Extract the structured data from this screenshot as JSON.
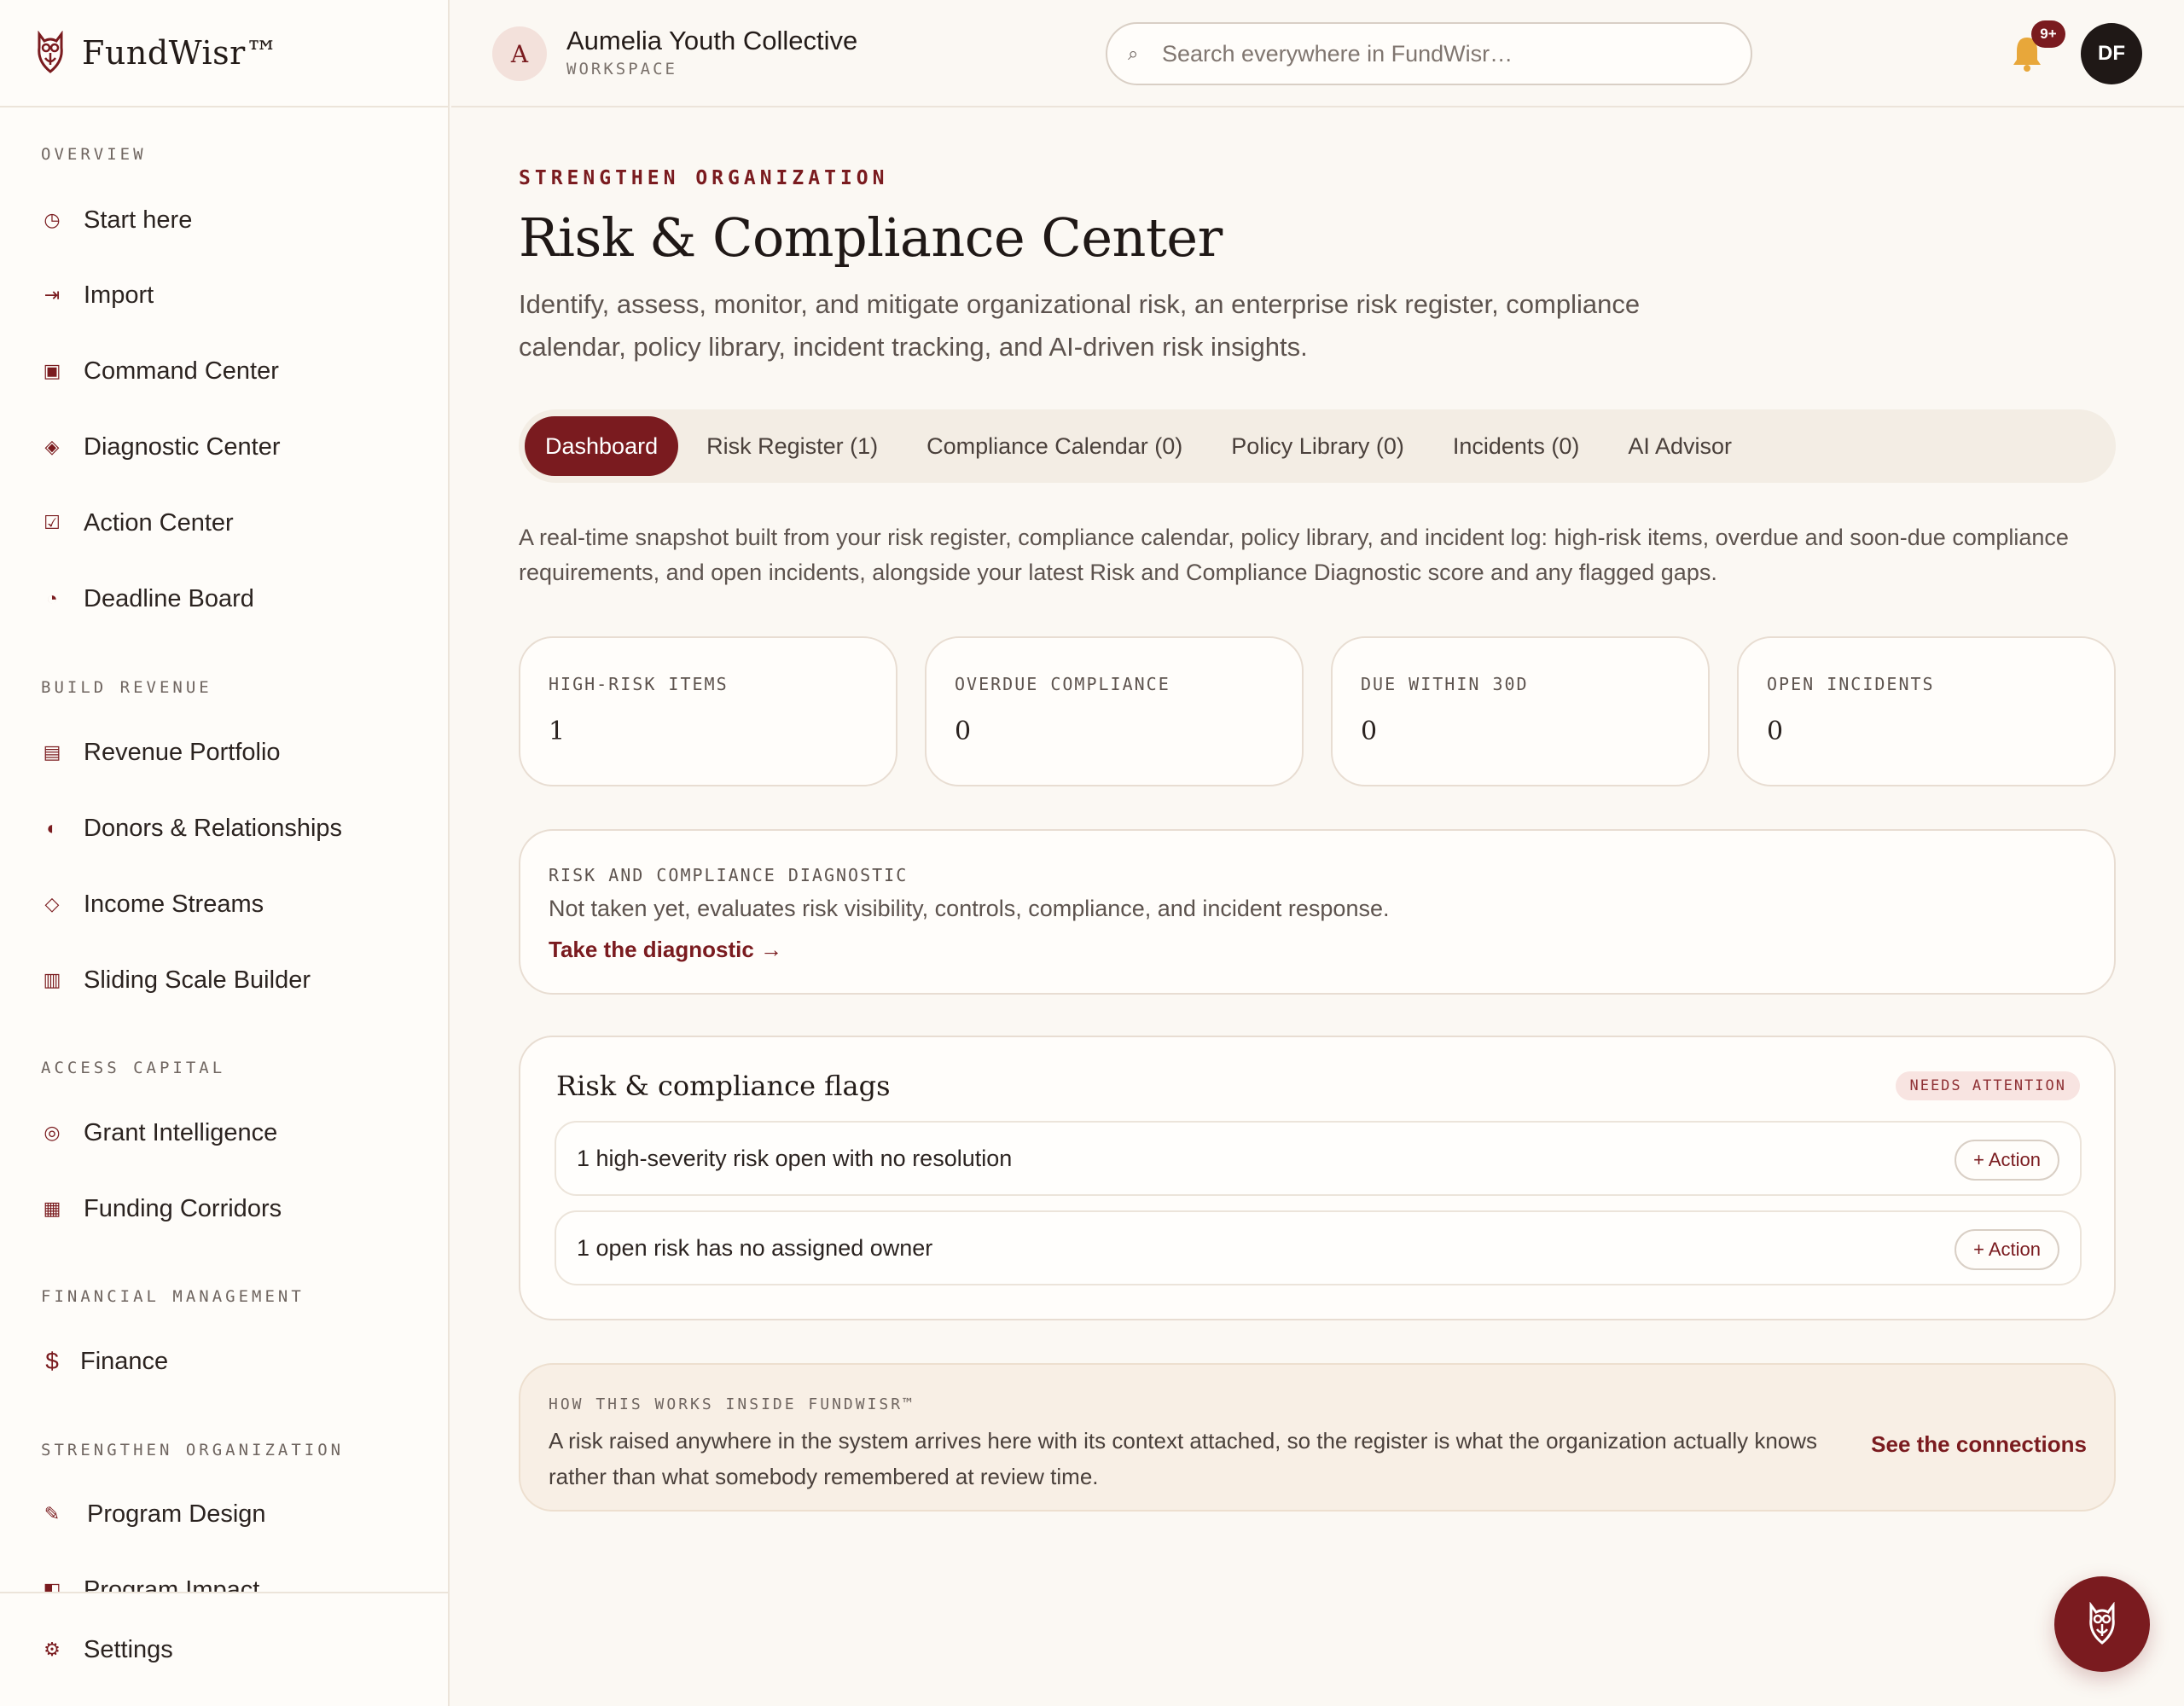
{
  "brand": {
    "name": "FundWisr™"
  },
  "workspace": {
    "initial": "A",
    "name": "Aumelia Youth Collective",
    "label": "WORKSPACE"
  },
  "search": {
    "placeholder": "Search everywhere in FundWisr…",
    "value": ""
  },
  "notifications": {
    "badge": "9+"
  },
  "user": {
    "initials": "DF"
  },
  "sidebar": {
    "sections": [
      {
        "title": "OVERVIEW",
        "items": [
          {
            "label": "Start here",
            "icon": "clock-icon"
          },
          {
            "label": "Import",
            "icon": "import-arrow-icon"
          },
          {
            "label": "Command Center",
            "icon": "square-target-icon"
          },
          {
            "label": "Diagnostic Center",
            "icon": "diamond-dot-icon"
          },
          {
            "label": "Action Center",
            "icon": "checkbox-icon"
          },
          {
            "label": "Deadline Board",
            "icon": "pie-clock-icon"
          }
        ]
      },
      {
        "title": "BUILD REVENUE",
        "items": [
          {
            "label": "Revenue Portfolio",
            "icon": "list-box-icon"
          },
          {
            "label": "Donors & Relationships",
            "icon": "half-circle-icon"
          },
          {
            "label": "Income Streams",
            "icon": "diamond-outline-icon"
          },
          {
            "label": "Sliding Scale Builder",
            "icon": "bars-box-icon"
          }
        ]
      },
      {
        "title": "ACCESS CAPITAL",
        "items": [
          {
            "label": "Grant Intelligence",
            "icon": "target-circle-icon"
          },
          {
            "label": "Funding Corridors",
            "icon": "grid-icon"
          }
        ]
      },
      {
        "title": "FINANCIAL MANAGEMENT",
        "items": [
          {
            "label": "Finance",
            "icon": "dollar-icon"
          }
        ]
      },
      {
        "title": "STRENGTHEN ORGANIZATION",
        "items": [
          {
            "label": "Program Design",
            "icon": "pencil-icon"
          },
          {
            "label": "Program Impact",
            "icon": "half-square-icon"
          }
        ]
      }
    ],
    "settings": {
      "label": "Settings",
      "icon": "gear-icon"
    }
  },
  "page": {
    "eyebrow": "STRENGTHEN ORGANIZATION",
    "title": "Risk & Compliance Center",
    "description": "Identify, assess, monitor, and mitigate organizational risk, an enterprise risk register, compliance calendar, policy library, incident tracking, and AI-driven risk insights.",
    "tabs": [
      {
        "label": "Dashboard",
        "active": true
      },
      {
        "label": "Risk Register (1)",
        "active": false
      },
      {
        "label": "Compliance Calendar (0)",
        "active": false
      },
      {
        "label": "Policy Library (0)",
        "active": false
      },
      {
        "label": "Incidents (0)",
        "active": false
      },
      {
        "label": "AI Advisor",
        "active": false
      }
    ],
    "intro": "A real-time snapshot built from your risk register, compliance calendar, policy library, and incident log: high-risk items, overdue and soon-due compliance requirements, and open incidents, alongside your latest Risk and Compliance Diagnostic score and any flagged gaps.",
    "stats": [
      {
        "label": "HIGH-RISK ITEMS",
        "value": "1"
      },
      {
        "label": "OVERDUE COMPLIANCE",
        "value": "0"
      },
      {
        "label": "DUE WITHIN 30D",
        "value": "0"
      },
      {
        "label": "OPEN INCIDENTS",
        "value": "0"
      }
    ],
    "diagnostic": {
      "label": "RISK AND COMPLIANCE DIAGNOSTIC",
      "text": "Not taken yet, evaluates risk visibility, controls, compliance, and incident response.",
      "link": "Take the diagnostic →"
    },
    "flags": {
      "title": "Risk & compliance flags",
      "badge": "NEEDS ATTENTION",
      "items": [
        {
          "text": "1 high-severity risk open with no resolution",
          "action": "+ Action"
        },
        {
          "text": "1 open risk has no assigned owner",
          "action": "+ Action"
        }
      ]
    },
    "how": {
      "label": "HOW THIS WORKS INSIDE FUNDWISR™",
      "text": "A risk raised anywhere in the system arrives here with its context attached, so the register is what the organization actually knows rather than what somebody remembered at review time.",
      "link": "See the connections"
    }
  },
  "colors": {
    "accent": "#7a1b1f",
    "background": "#fbf8f3",
    "card": "#fffdfa",
    "bell": "#e8a73a"
  }
}
